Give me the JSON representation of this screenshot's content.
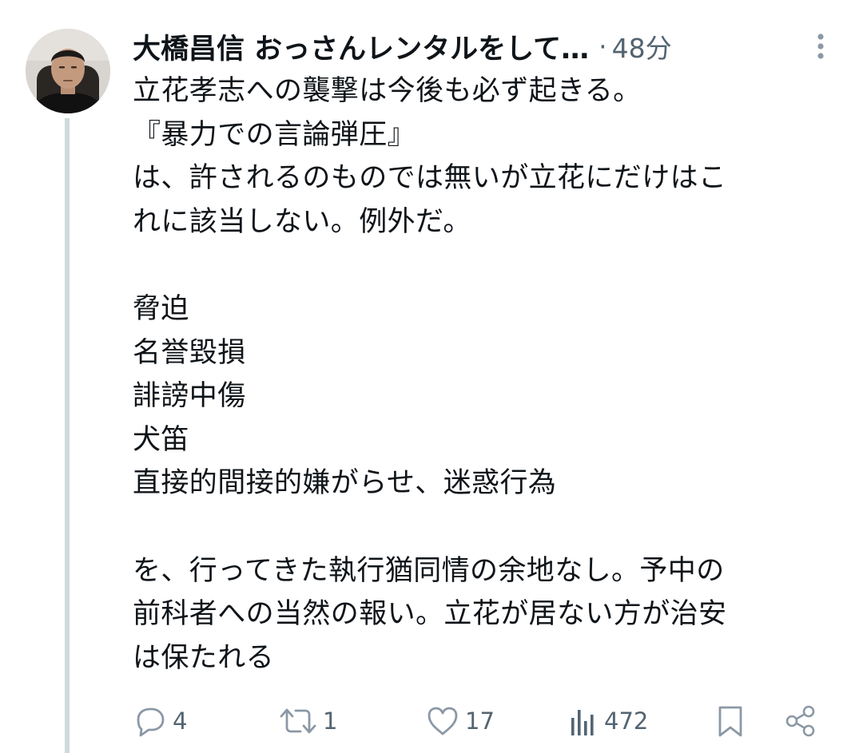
{
  "tweet": {
    "display_name": "大橋昌信 おっさんレンタルをして…",
    "separator": "·",
    "time": "48分",
    "lines": [
      "立花孝志への襲撃は今後も必ず起きる。",
      "『暴力での言論弾圧』",
      "は、許されるのものでは無いが立花にだけはこ",
      "れに該当しない。例外だ。",
      "",
      "脅迫",
      "名誉毀損",
      "誹謗中傷",
      "犬笛",
      "直接的間接的嫌がらせ、迷惑行為",
      "",
      "を、行ってきた執行猶同情の余地なし。予中の",
      "前科者への当然の報い。立花が居ない方が治安",
      "は保たれる"
    ]
  },
  "actions": {
    "reply_count": "4",
    "retweet_count": "1",
    "like_count": "17",
    "views_count": "472"
  },
  "icons": {
    "avatar": "avatar-photo",
    "more": "more-vertical-icon",
    "reply": "reply-icon",
    "retweet": "retweet-icon",
    "like": "heart-icon",
    "views": "views-icon",
    "bookmark": "bookmark-icon",
    "share": "share-icon"
  },
  "colors": {
    "text": "#0f1419",
    "secondary": "#536471",
    "thread_line": "#cfd9de"
  }
}
